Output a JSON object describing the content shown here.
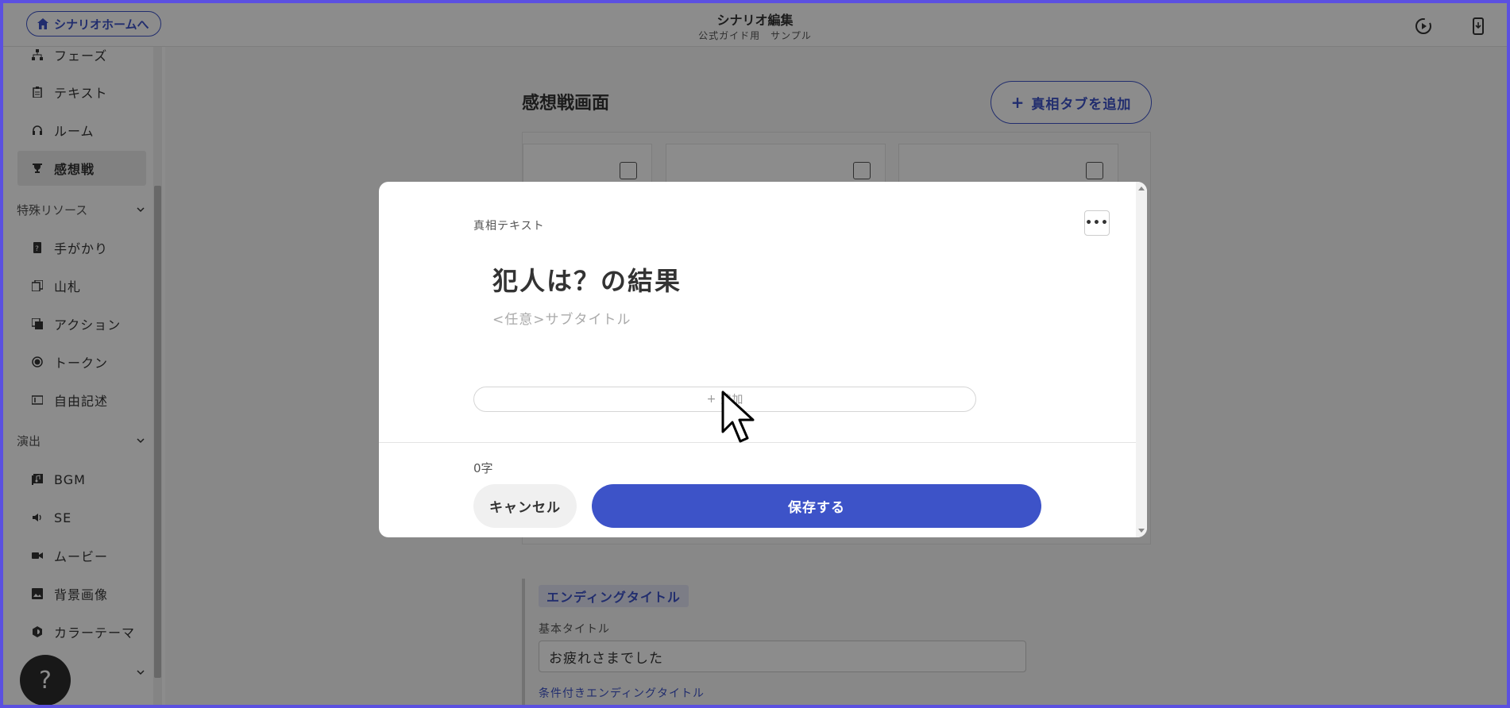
{
  "header": {
    "home_button": "シナリオホームへ",
    "title": "シナリオ編集",
    "subtitle": "公式ガイド用　サンプル"
  },
  "sidebar": {
    "items_top": [
      {
        "label": "フェーズ",
        "icon": "sitemap-icon"
      },
      {
        "label": "テキスト",
        "icon": "clipboard-icon"
      },
      {
        "label": "ルーム",
        "icon": "headphones-icon"
      },
      {
        "label": "感想戦",
        "icon": "trophy-icon",
        "active": true
      }
    ],
    "section_special": "特殊リソース",
    "items_special": [
      {
        "label": "手がかり",
        "icon": "clue-card-icon"
      },
      {
        "label": "山札",
        "icon": "deck-icon"
      },
      {
        "label": "アクション",
        "icon": "action-icon"
      },
      {
        "label": "トークン",
        "icon": "token-icon"
      },
      {
        "label": "自由記述",
        "icon": "free-text-icon"
      }
    ],
    "section_effects": "演出",
    "items_effects": [
      {
        "label": "BGM",
        "icon": "music-icon"
      },
      {
        "label": "SE",
        "icon": "speaker-icon"
      },
      {
        "label": "ムービー",
        "icon": "video-icon"
      },
      {
        "label": "背景画像",
        "icon": "image-icon"
      },
      {
        "label": "カラーテーマ",
        "icon": "palette-icon"
      }
    ]
  },
  "main": {
    "title": "感想戦画面",
    "add_tab_button": "真相タブを追加",
    "ending_tag": "エンディングタイトル",
    "basic_title_label": "基本タイトル",
    "basic_title_value": "お疲れさまでした",
    "conditional_label": "条件付きエンディングタイトル"
  },
  "modal": {
    "label": "真相テキスト",
    "more_button": "•••",
    "heading": "犯人は？の結果",
    "subtitle_placeholder": "<任意>サブタイトル",
    "add_button": "追加",
    "char_count": "0字",
    "cancel_button": "キャンセル",
    "save_button": "保存する"
  },
  "help_button": "?",
  "colors": {
    "accent": "#3d53c8",
    "frame": "#5b50e0"
  }
}
